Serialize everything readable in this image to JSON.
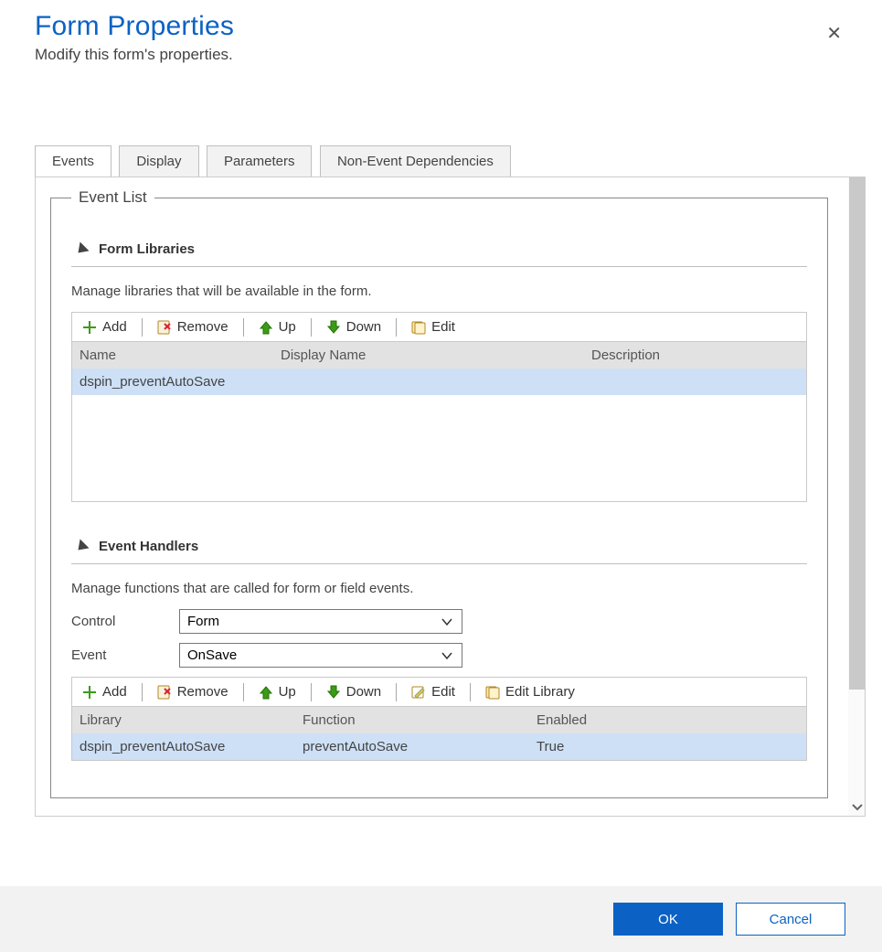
{
  "header": {
    "title": "Form Properties",
    "subtitle": "Modify this form's properties."
  },
  "tabs": [
    {
      "label": "Events",
      "active": true
    },
    {
      "label": "Display",
      "active": false
    },
    {
      "label": "Parameters",
      "active": false
    },
    {
      "label": "Non-Event Dependencies",
      "active": false
    }
  ],
  "event_list": {
    "legend": "Event List",
    "libraries": {
      "heading": "Form Libraries",
      "description": "Manage libraries that will be available in the form.",
      "toolbar": {
        "add": "Add",
        "remove": "Remove",
        "up": "Up",
        "down": "Down",
        "edit": "Edit"
      },
      "columns": {
        "name": "Name",
        "display_name": "Display Name",
        "description": "Description"
      },
      "rows": [
        {
          "name": "dspin_preventAutoSave",
          "display_name": "",
          "description": ""
        }
      ]
    },
    "handlers": {
      "heading": "Event Handlers",
      "description": "Manage functions that are called for form or field events.",
      "control_label": "Control",
      "control_value": "Form",
      "event_label": "Event",
      "event_value": "OnSave",
      "toolbar": {
        "add": "Add",
        "remove": "Remove",
        "up": "Up",
        "down": "Down",
        "edit": "Edit",
        "edit_library": "Edit Library"
      },
      "columns": {
        "library": "Library",
        "function": "Function",
        "enabled": "Enabled"
      },
      "rows": [
        {
          "library": "dspin_preventAutoSave",
          "function": "preventAutoSave",
          "enabled": "True"
        }
      ]
    }
  },
  "footer": {
    "ok": "OK",
    "cancel": "Cancel"
  }
}
